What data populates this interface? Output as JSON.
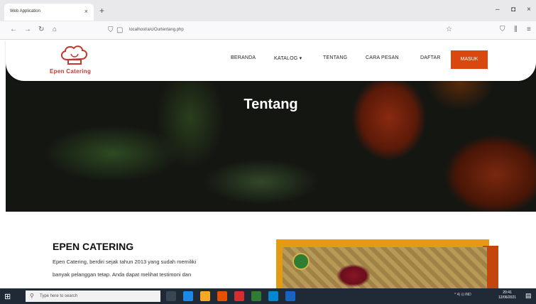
{
  "browser": {
    "tab_title": "Web Application",
    "tab_close": "×",
    "new_tab": "+",
    "url": "localhost/a/c/Ourtentang.php",
    "window_min": "–",
    "window_max": "◘",
    "window_close": "×"
  },
  "header": {
    "logo_text": "Epen Catering",
    "menu": [
      "BERANDA",
      "KATALOG ▾",
      "TENTANG",
      "CARA PESAN",
      "DAFTAR"
    ],
    "login_label": "MASUK",
    "accent_color": "#d9480f"
  },
  "hero": {
    "title": "Tentang"
  },
  "about": {
    "title": "EPEN CATERING",
    "lines": [
      "Epen Catering, berdiri sejak tahun 2013 yang sudah memiliki",
      "banyak pelanggan tetap. Anda dapat melihat testimoni dan"
    ]
  },
  "taskbar": {
    "search_placeholder": "Type here to search",
    "tray": "^ 4) ⊡ IND",
    "time": "20:41",
    "date": "12/06/2021"
  }
}
